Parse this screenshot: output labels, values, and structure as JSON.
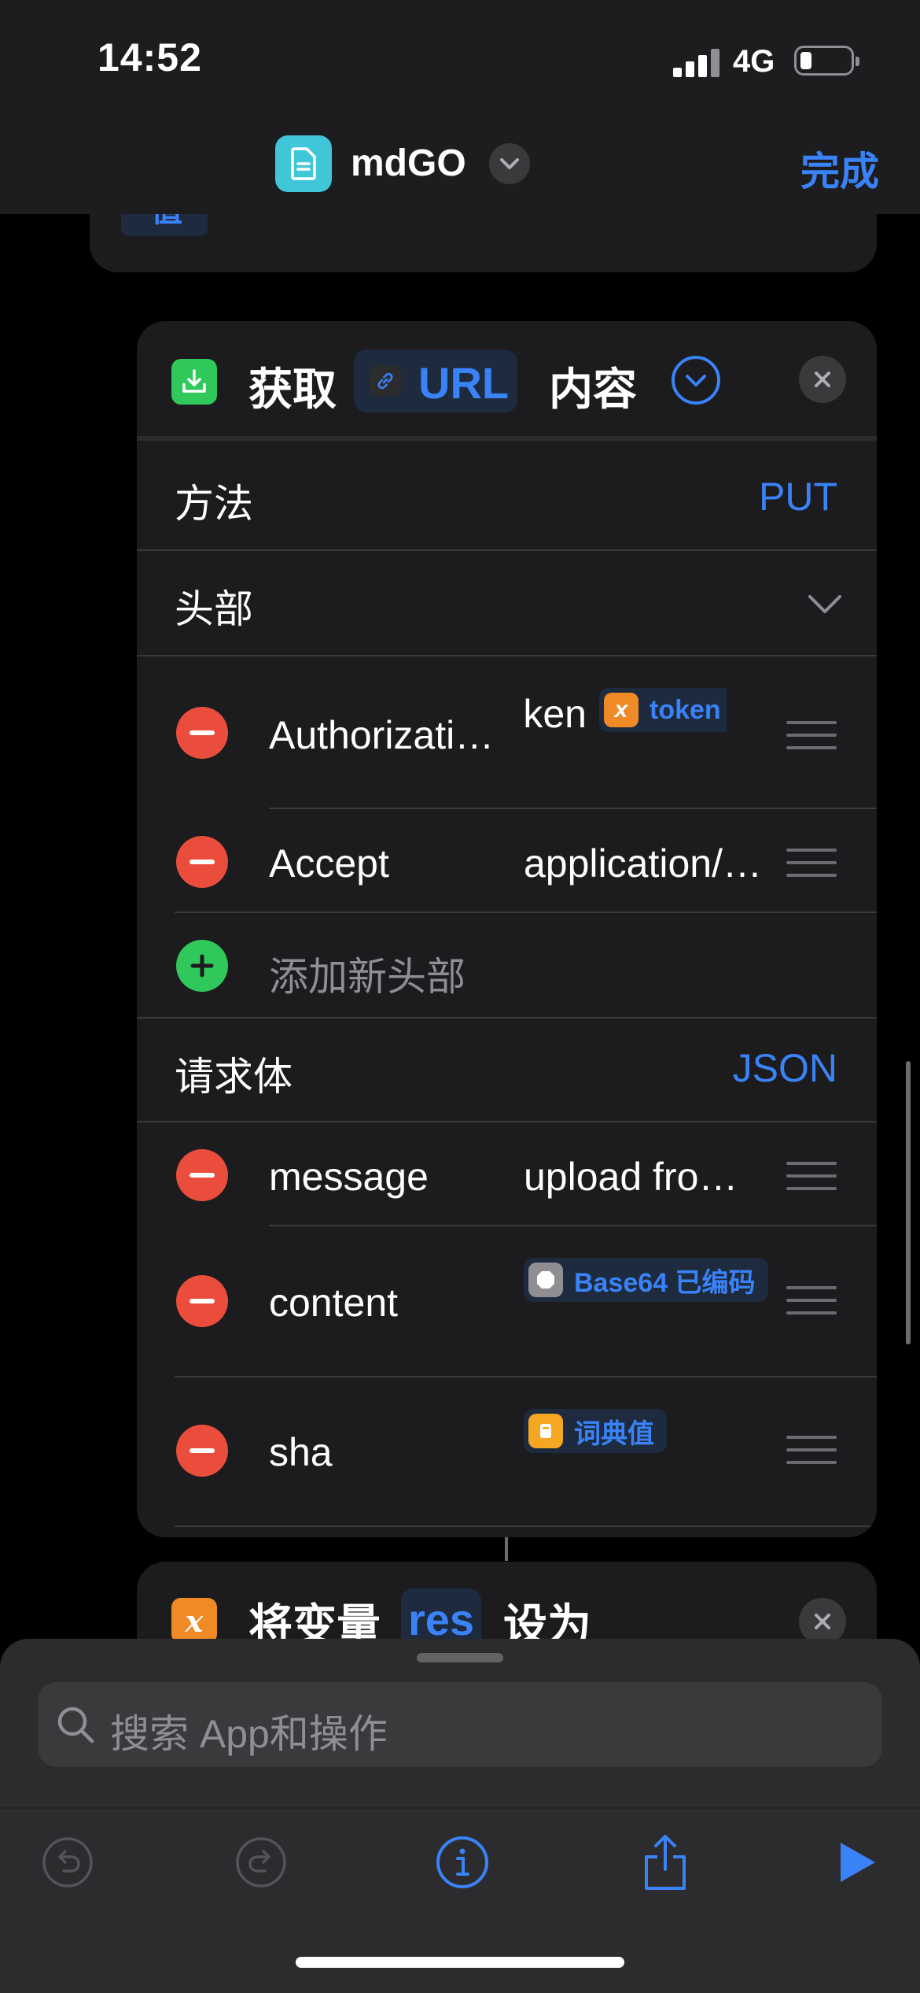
{
  "status_bar": {
    "time": "14:52",
    "network": "4G"
  },
  "nav": {
    "app_name": "mdGO",
    "done_label": "完成"
  },
  "prev_card": {
    "token": "值"
  },
  "action": {
    "prefix": "获取",
    "url_token": "URL",
    "suffix": "内容",
    "method": {
      "label": "方法",
      "value": "PUT"
    },
    "headers": {
      "label": "头部",
      "items": [
        {
          "key": "Authorizati…",
          "value_text": "token",
          "value_var": "token"
        },
        {
          "key": "Accept",
          "value_text": "application/…"
        }
      ],
      "add_label": "添加新头部"
    },
    "body": {
      "label": "请求体",
      "type": "JSON",
      "items": [
        {
          "key": "message",
          "value_text": "upload fro…"
        },
        {
          "key": "content",
          "value_var": "Base64 已编码"
        },
        {
          "key": "sha",
          "value_var": "词典值"
        }
      ]
    }
  },
  "next_action": {
    "prefix": "将变量",
    "var": "res",
    "suffix": "设为"
  },
  "search": {
    "placeholder": "搜索 App和操作"
  },
  "colors": {
    "accent": "#3a82f7",
    "danger": "#eb4d3d",
    "success": "#30c85a",
    "variable": "#f08a27",
    "card": "#1c1c1e"
  },
  "icons": [
    "document-icon",
    "chevron-down-icon",
    "download-icon",
    "link-icon",
    "close-icon",
    "variable-icon",
    "base64-icon",
    "dictionary-icon",
    "search-icon",
    "undo-icon",
    "redo-icon",
    "info-icon",
    "share-icon",
    "play-icon"
  ]
}
